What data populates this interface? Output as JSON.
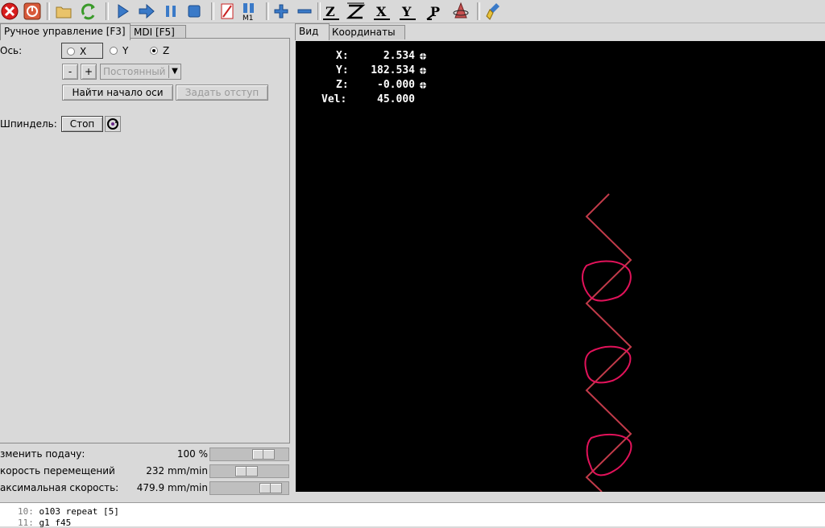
{
  "toolbar": {
    "icons": [
      "estop-icon",
      "power-icon",
      "open-file-icon",
      "reload-icon",
      "run-icon",
      "step-icon",
      "pause-icon",
      "stop-icon",
      "block-delete-icon",
      "optional-stop-icon",
      "zoom-in-icon",
      "zoom-out-icon",
      "view-z-icon",
      "view-z2-icon",
      "view-x-icon",
      "view-y-icon",
      "view-p-icon",
      "rotate-icon",
      "clear-plot-icon"
    ],
    "letters": {
      "z": "Z",
      "z2": "Z",
      "x": "X",
      "y": "Y",
      "p": "P",
      "m1": "M1"
    }
  },
  "left_tabs": [
    {
      "label": "Ручное управление [F3]"
    },
    {
      "label": "MDI [F5]"
    }
  ],
  "right_tabs": [
    {
      "label": "Вид"
    },
    {
      "label": "Координаты"
    }
  ],
  "manual": {
    "axis_label": "Ось:",
    "axes": [
      {
        "label": "X",
        "selected": false
      },
      {
        "label": "Y",
        "selected": false
      },
      {
        "label": "Z",
        "selected": true
      }
    ],
    "minus_label": "-",
    "plus_label": "+",
    "jog_mode": "Постоянный",
    "home_button": "Найти начало оси",
    "offset_button": "Задать отступ",
    "spindle_label": "Шпиндель:",
    "spindle_stop": "Стоп"
  },
  "sliders": [
    {
      "label": "зменить подачу:",
      "value": "100 %",
      "fraction": 0.75
    },
    {
      "label": "корость перемещений",
      "value": "232 mm/min",
      "fraction": 0.45
    },
    {
      "label": "аксимальная скорость:",
      "value": "479.9 mm/min",
      "fraction": 0.88
    }
  ],
  "dro": [
    {
      "label": "X:",
      "value": "2.534"
    },
    {
      "label": "Y:",
      "value": "182.534"
    },
    {
      "label": "Z:",
      "value": "-0.000"
    },
    {
      "label": "Vel:",
      "value": "45.000"
    }
  ],
  "code": [
    {
      "line": "10:",
      "text": "o103 repeat [5]"
    },
    {
      "line": "11:",
      "text": "g1 f45"
    }
  ],
  "colors": {
    "feed": "#e2125a",
    "rapid": "#c23b4a",
    "background": "#000000"
  }
}
